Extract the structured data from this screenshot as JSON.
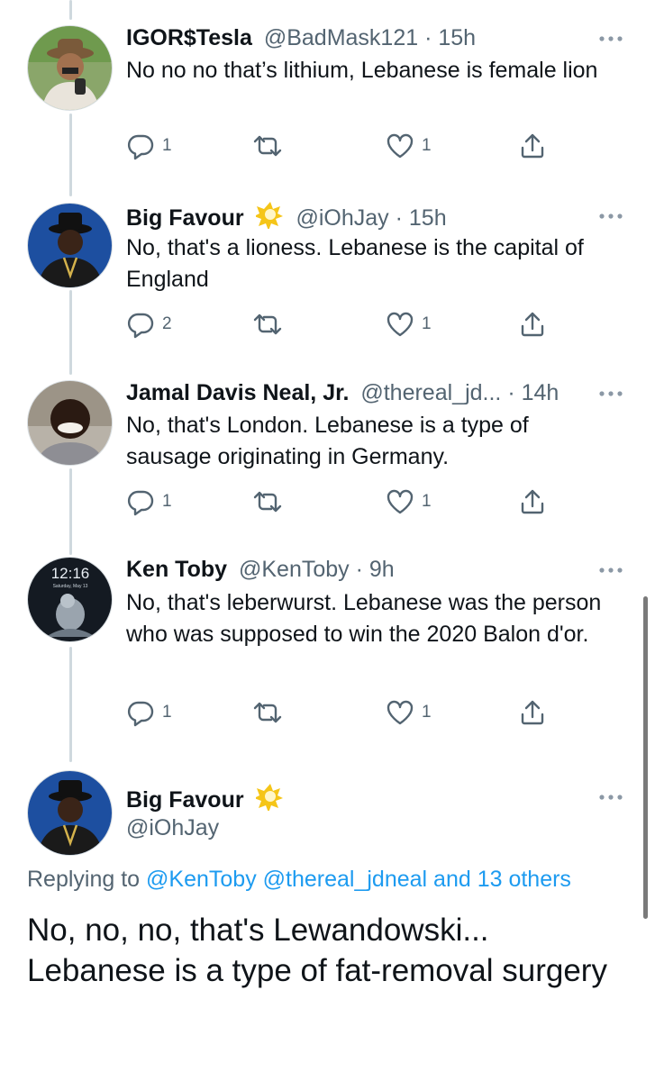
{
  "tweets": [
    {
      "name": "IGOR$Tesla",
      "handle": "@BadMask121",
      "dot": "·",
      "time": "15h",
      "verified": false,
      "text": "No no no that’s lithium, Lebanese is female lion",
      "replies": "1",
      "retweets": "",
      "likes": "1"
    },
    {
      "name": "Big Favour",
      "handle": "@iOhJay",
      "dot": "·",
      "time": "15h",
      "verified": true,
      "text": "No, that's a lioness. Lebanese is the capital of England",
      "replies": "2",
      "retweets": "",
      "likes": "1"
    },
    {
      "name": "Jamal Davis Neal, Jr.",
      "handle": "@thereal_jd...",
      "dot": "·",
      "time": "14h",
      "verified": false,
      "text": "No, that's London. Lebanese is a type of sausage originating in Germany.",
      "replies": "1",
      "retweets": "",
      "likes": "1"
    },
    {
      "name": "Ken Toby",
      "handle": "@KenToby",
      "dot": "·",
      "time": "9h",
      "verified": false,
      "avatar_text": {
        "clock": "12:16",
        "date": "Saturday, May 13"
      },
      "text": "No, that's leberwurst. Lebanese was the person who was supposed to win the 2020 Balon d'or.",
      "replies": "1",
      "retweets": "",
      "likes": "1"
    }
  ],
  "main_tweet": {
    "name": "Big Favour",
    "handle": "@iOhJay",
    "verified": true,
    "replying_prefix": "Replying to ",
    "replying_to": "@KenToby @thereal_jdneal and 13 others",
    "text": "No, no, no, that's Lewandowski... Lebanese is a type of fat-removal surgery"
  },
  "icons": [
    "reply-icon",
    "retweet-icon",
    "like-icon",
    "share-icon",
    "more-icon",
    "verified-icon"
  ],
  "colors": {
    "text": "#0f1419",
    "secondary": "#536471",
    "link": "#1d9bf0",
    "thread_line": "#cfd9de",
    "verified_badge": "#f5c518"
  }
}
